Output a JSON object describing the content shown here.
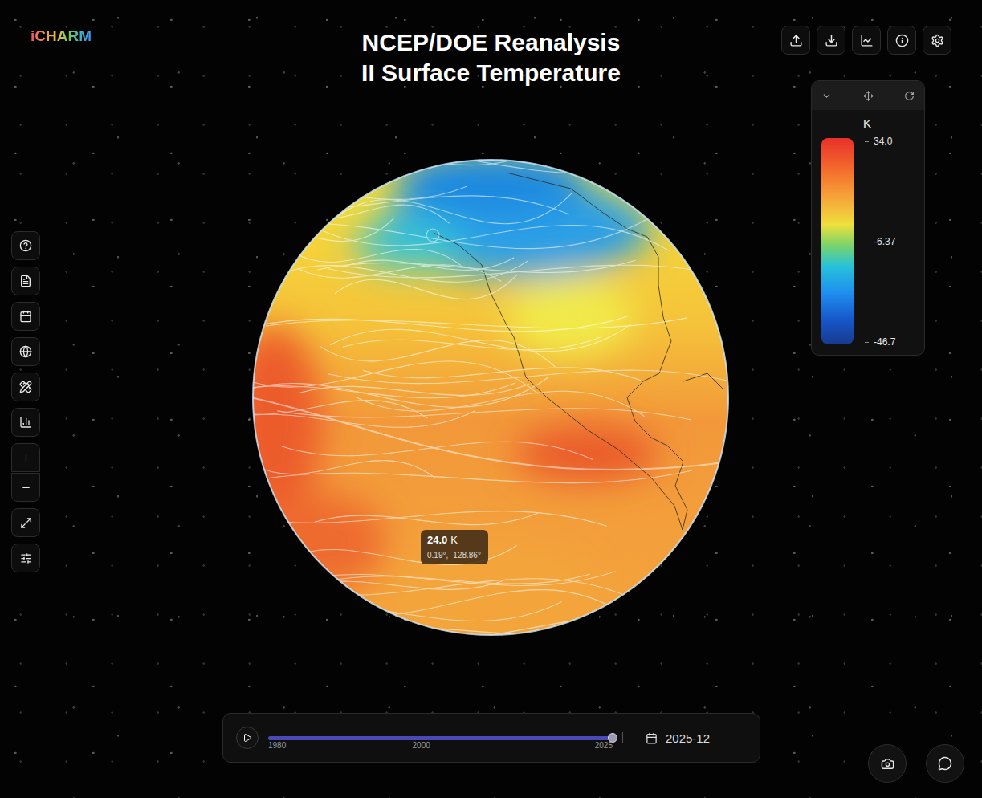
{
  "app": {
    "logo": "iCHARM"
  },
  "title": {
    "lines": [
      "NCEP/DOE Reanalysis",
      "II Surface Temperature"
    ]
  },
  "legend": {
    "unit": "K",
    "ticks": [
      "34.0",
      "-6.37",
      "-46.7"
    ]
  },
  "tooltip": {
    "value": "24.0",
    "unit": "K",
    "coords": "0.19°, -128.86°"
  },
  "timeline": {
    "playing": false,
    "level": 1.0,
    "ticks": [
      "1980",
      "2000",
      "2025"
    ],
    "date": "2025-12"
  }
}
